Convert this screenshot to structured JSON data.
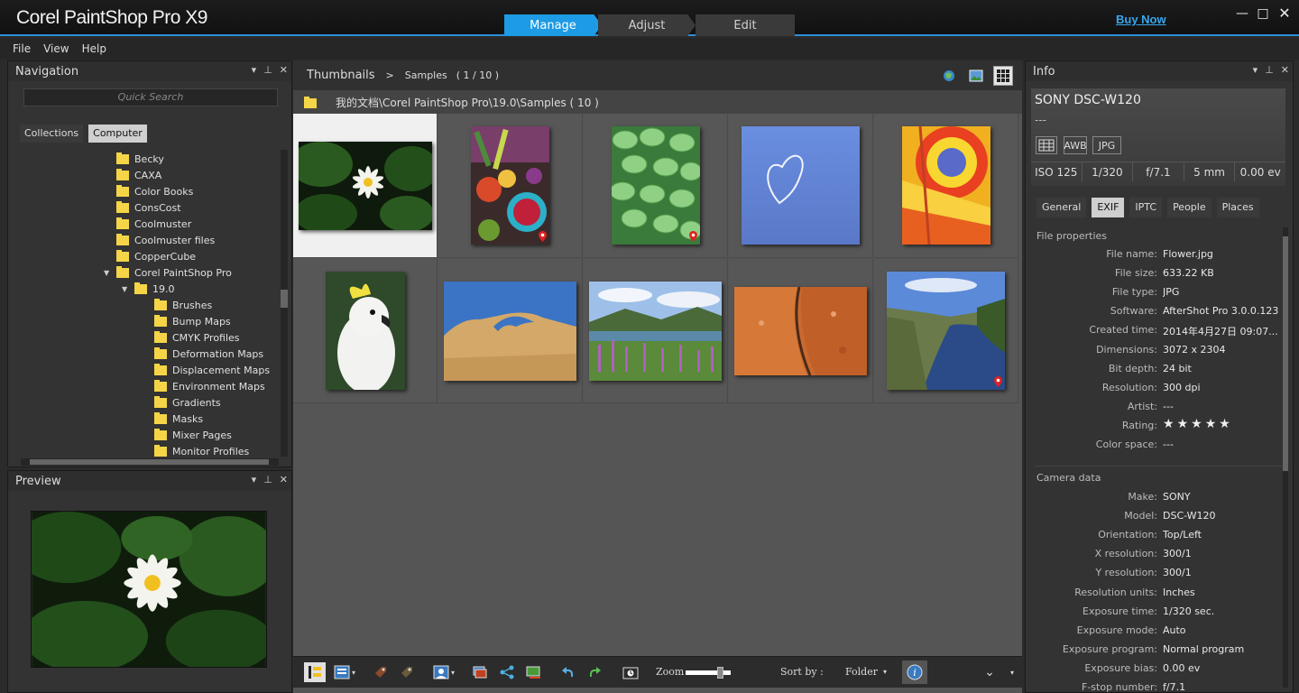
{
  "app": {
    "title": "Corel PaintShop Pro X9",
    "modes": [
      "Manage",
      "Adjust",
      "Edit"
    ],
    "active_mode": "Manage",
    "buy_now": "Buy Now",
    "accent": "#1d9be4"
  },
  "menu": {
    "file": "File",
    "view": "View",
    "help": "Help"
  },
  "navigation": {
    "title": "Navigation",
    "search_placeholder": "Quick Search",
    "tabs": {
      "collections": "Collections",
      "computer": "Computer"
    },
    "tree": [
      {
        "label": "Becky",
        "level": 0
      },
      {
        "label": "CAXA",
        "level": 0
      },
      {
        "label": "Color Books",
        "level": 0
      },
      {
        "label": "ConsCost",
        "level": 0
      },
      {
        "label": "Coolmuster",
        "level": 0
      },
      {
        "label": "Coolmuster files",
        "level": 0
      },
      {
        "label": "CopperCube",
        "level": 0
      },
      {
        "label": "Corel PaintShop Pro",
        "level": 0,
        "expanded": true
      },
      {
        "label": "19.0",
        "level": 1,
        "expanded": true
      },
      {
        "label": "Brushes",
        "level": 2
      },
      {
        "label": "Bump Maps",
        "level": 2
      },
      {
        "label": "CMYK Profiles",
        "level": 2
      },
      {
        "label": "Deformation Maps",
        "level": 2
      },
      {
        "label": "Displacement Maps",
        "level": 2
      },
      {
        "label": "Environment Maps",
        "level": 2
      },
      {
        "label": "Gradients",
        "level": 2
      },
      {
        "label": "Masks",
        "level": 2
      },
      {
        "label": "Mixer Pages",
        "level": 2
      },
      {
        "label": "Monitor Profiles",
        "level": 2
      }
    ]
  },
  "preview": {
    "title": "Preview"
  },
  "browser": {
    "breadcrumb_root": "Thumbnails",
    "breadcrumb_sep": ">",
    "breadcrumb_current": "Samples",
    "breadcrumb_count": "( 1 / 10 )",
    "path": "我的文档\\Corel PaintShop Pro\\19.0\\Samples ( 10 )"
  },
  "toolbar": {
    "zoom_label": "Zoom",
    "sort_label": "Sort by :",
    "sort_value": "Folder",
    "zoom_level": 0.75
  },
  "info": {
    "title": "Info",
    "model": "SONY DSC-W120",
    "subtitle": "---",
    "badges": {
      "awb": "AWB",
      "format": "JPG"
    },
    "exposure": [
      "ISO 125",
      "1/320",
      "f/7.1",
      "5 mm",
      "0.00 ev"
    ],
    "tabs": [
      "General",
      "EXIF",
      "IPTC",
      "People",
      "Places"
    ],
    "active_tab": "EXIF",
    "file_section": "File properties",
    "file_props": [
      {
        "key": "File name:",
        "value": "Flower.jpg"
      },
      {
        "key": "File size:",
        "value": "633.22 KB"
      },
      {
        "key": "File type:",
        "value": "JPG"
      },
      {
        "key": "Software:",
        "value": "AfterShot Pro 3.0.0.123"
      },
      {
        "key": "Created time:",
        "value": "2014年4月27日 09:07..."
      },
      {
        "key": "Dimensions:",
        "value": "3072 x 2304"
      },
      {
        "key": "Bit depth:",
        "value": "24 bit"
      },
      {
        "key": "Resolution:",
        "value": "300 dpi"
      },
      {
        "key": "Artist:",
        "value": "---"
      },
      {
        "key": "Rating:",
        "value": "",
        "stars": 5
      },
      {
        "key": "Color space:",
        "value": "---"
      }
    ],
    "camera_section": "Camera data",
    "camera_props": [
      {
        "key": "Make:",
        "value": "SONY"
      },
      {
        "key": "Model:",
        "value": "DSC-W120"
      },
      {
        "key": "Orientation:",
        "value": "Top/Left"
      },
      {
        "key": "X resolution:",
        "value": "300/1"
      },
      {
        "key": "Y resolution:",
        "value": "300/1"
      },
      {
        "key": "Resolution units:",
        "value": "Inches"
      },
      {
        "key": "Exposure time:",
        "value": "1/320 sec."
      },
      {
        "key": "Exposure mode:",
        "value": "Auto"
      },
      {
        "key": "Exposure program:",
        "value": "Normal program"
      },
      {
        "key": "Exposure bias:",
        "value": "0.00 ev"
      },
      {
        "key": "F-stop number:",
        "value": "f/7.1"
      }
    ]
  }
}
